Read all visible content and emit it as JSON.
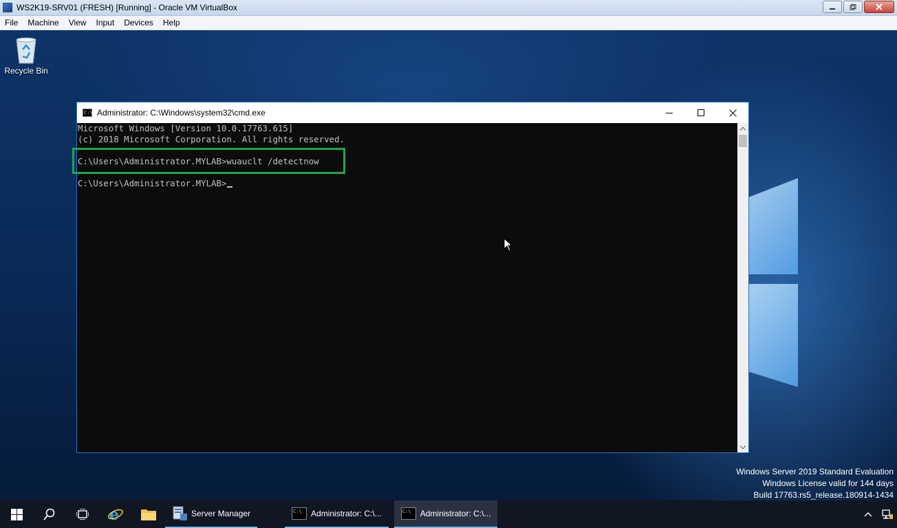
{
  "host": {
    "title": "WS2K19-SRV01 (FRESH) [Running] - Oracle VM VirtualBox",
    "menu": [
      "File",
      "Machine",
      "View",
      "Input",
      "Devices",
      "Help"
    ]
  },
  "desktop": {
    "recycle_bin_label": "Recycle Bin"
  },
  "cmd": {
    "title": "Administrator: C:\\Windows\\system32\\cmd.exe",
    "lines": [
      "Microsoft Windows [Version 10.0.17763.615]",
      "(c) 2018 Microsoft Corporation. All rights reserved.",
      "",
      "C:\\Users\\Administrator.MYLAB>wuauclt /detectnow",
      "",
      "C:\\Users\\Administrator.MYLAB>"
    ],
    "icon_text": "C:\\"
  },
  "watermark": {
    "line1": "Windows Server 2019 Standard Evaluation",
    "line2": "Windows License valid for 144 days",
    "line3": "Build 17763.rs5_release.180914-1434"
  },
  "taskbar": {
    "apps": [
      {
        "label": "Server Manager"
      },
      {
        "label": "Administrator: C:\\..."
      },
      {
        "label": "Administrator: C:\\..."
      }
    ]
  },
  "colors": {
    "highlight": "#1fa64c",
    "console_bg": "#0c0c0c",
    "console_fg": "#c0c0c0"
  }
}
